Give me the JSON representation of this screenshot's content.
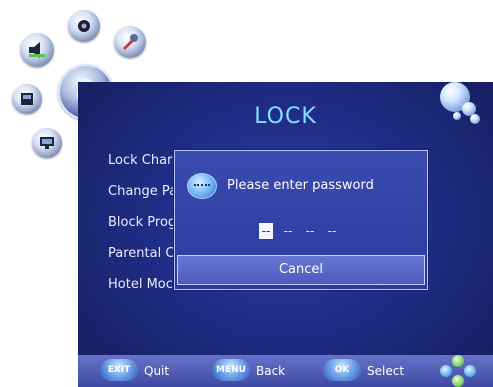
{
  "menu": {
    "title": "LOCK",
    "items": [
      {
        "label": "Lock Char"
      },
      {
        "label": "Change Pa"
      },
      {
        "label": "Block Prog"
      },
      {
        "label": "Parental C"
      },
      {
        "label": "Hotel Moc"
      }
    ]
  },
  "dialog": {
    "prompt": "Please enter password",
    "password_slots": [
      "--",
      "--",
      "--",
      "--"
    ],
    "active_slot": 0,
    "cancel_label": "Cancel"
  },
  "hints": [
    {
      "key": "EXIT",
      "label": "Quit"
    },
    {
      "key": "MENU",
      "label": "Back"
    },
    {
      "key": "OK",
      "label": "Select"
    }
  ],
  "icons": [
    "settings-icon",
    "speaker-icon",
    "tools-icon",
    "picture-icon",
    "lock-icon",
    "monitor-icon"
  ],
  "colors": {
    "panel": "#202d86",
    "title": "#7fe0ff",
    "dialog": "#3a4bb0",
    "hintbar": "#5563bf"
  }
}
